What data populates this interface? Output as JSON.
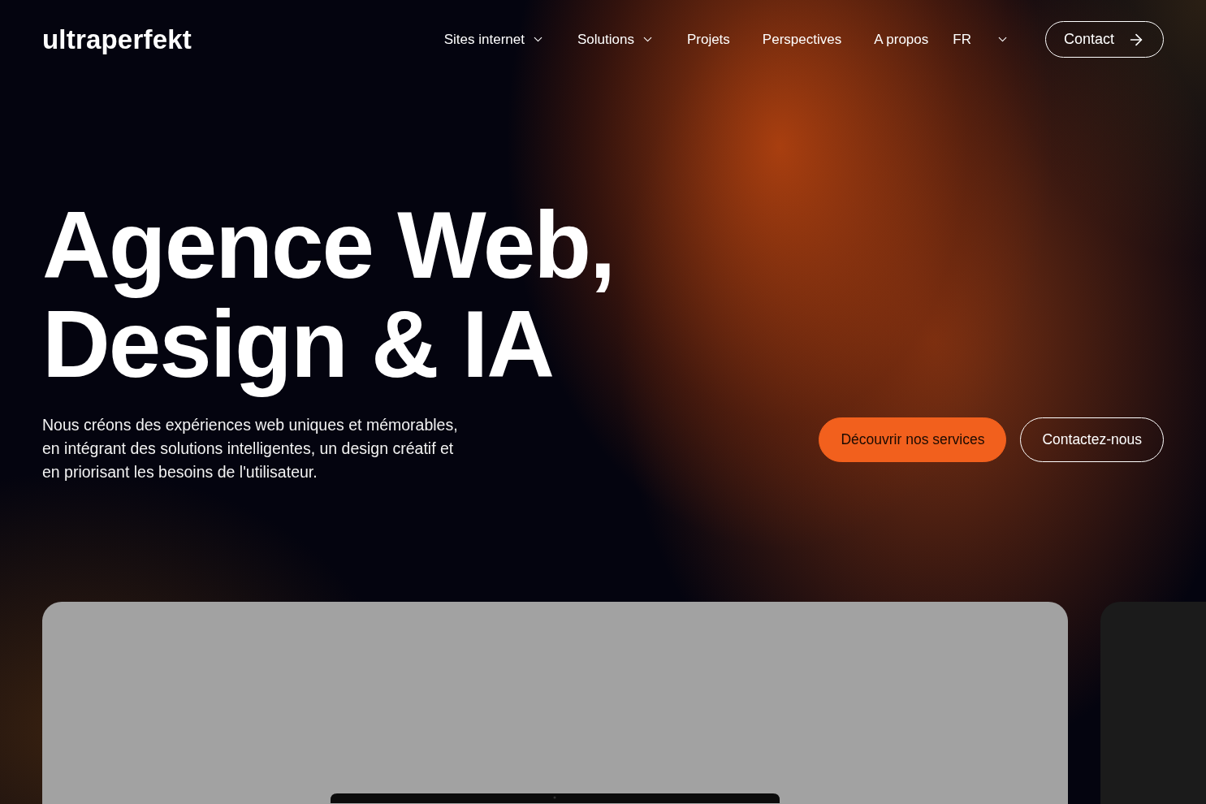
{
  "logo": "ultraperfekt",
  "nav": [
    {
      "label": "Sites internet",
      "has_menu": true
    },
    {
      "label": "Solutions",
      "has_menu": true
    },
    {
      "label": "Projets",
      "has_menu": false
    },
    {
      "label": "Perspectives",
      "has_menu": false
    },
    {
      "label": "A propos",
      "has_menu": false
    }
  ],
  "language": {
    "label": "FR"
  },
  "contact_button": {
    "label": "Contact"
  },
  "headline": [
    "Agence Web,",
    "Design & IA"
  ],
  "intro": "Nous créons des expériences web uniques et mémorables, en intégrant des solutions intelligentes, un design créatif et en priorisant les besoins de l'utilisateur.",
  "buttons": [
    {
      "label": "Découvrir nos services",
      "kind": "primary"
    },
    {
      "label": "Contactez-nous",
      "kind": "outline"
    }
  ]
}
